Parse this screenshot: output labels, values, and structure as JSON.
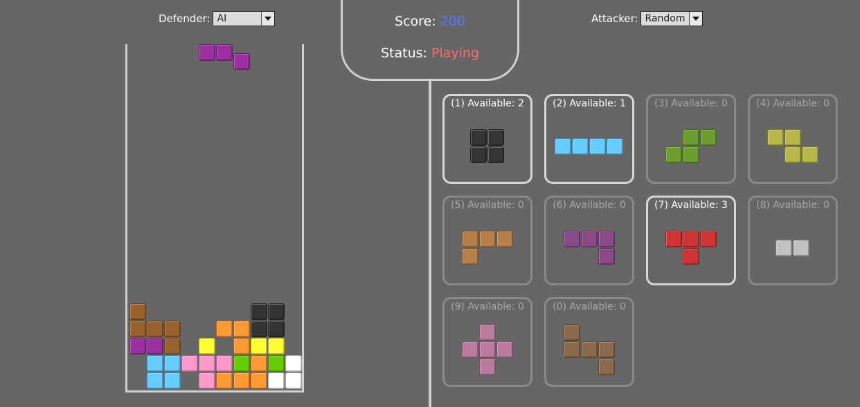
{
  "defender": {
    "label": "Defender:",
    "selected": "AI"
  },
  "attacker": {
    "label": "Attacker:",
    "selected": "Random"
  },
  "score": {
    "label": "Score:",
    "value": "200"
  },
  "status": {
    "label": "Status:",
    "value": "Playing"
  },
  "colors": {
    "black": "#353535",
    "cyan": "#66ccff",
    "green": "#6b9e2e",
    "olive": "#b8b84a",
    "tan": "#b5804a",
    "purple": "#8a4a8a",
    "red": "#d03333",
    "silver": "#c2c2c2",
    "pink": "#b87a9e",
    "brown": "#8a6a4a",
    "falling_purple": "#9b30a0",
    "b_brown": "#99612e",
    "b_orange": "#ff9933",
    "b_black": "#333333",
    "b_yellow": "#ffff33",
    "b_cyan": "#66ccff",
    "b_pink": "#ff99cc",
    "b_green": "#66cc00",
    "b_white": "#ffffff",
    "b_purple": "#9b30a0"
  },
  "board": {
    "columns": 10,
    "rows": 20,
    "falling_piece": {
      "color": "falling_purple",
      "cells": [
        [
          4,
          0
        ],
        [
          5,
          0
        ],
        [
          6,
          0.5
        ]
      ]
    },
    "settled": [
      {
        "c": 0,
        "r": 15,
        "k": "b_brown"
      },
      {
        "c": 7,
        "r": 15,
        "k": "b_black"
      },
      {
        "c": 8,
        "r": 15,
        "k": "b_black"
      },
      {
        "c": 0,
        "r": 16,
        "k": "b_brown"
      },
      {
        "c": 1,
        "r": 16,
        "k": "b_brown"
      },
      {
        "c": 2,
        "r": 16,
        "k": "b_brown"
      },
      {
        "c": 5,
        "r": 16,
        "k": "b_orange"
      },
      {
        "c": 6,
        "r": 16,
        "k": "b_orange"
      },
      {
        "c": 7,
        "r": 16,
        "k": "b_black"
      },
      {
        "c": 8,
        "r": 16,
        "k": "b_black"
      },
      {
        "c": 0,
        "r": 17,
        "k": "b_purple"
      },
      {
        "c": 1,
        "r": 17,
        "k": "b_purple"
      },
      {
        "c": 2,
        "r": 17,
        "k": "b_brown"
      },
      {
        "c": 4,
        "r": 17,
        "k": "b_yellow"
      },
      {
        "c": 6,
        "r": 17,
        "k": "b_orange"
      },
      {
        "c": 7,
        "r": 17,
        "k": "b_yellow"
      },
      {
        "c": 8,
        "r": 17,
        "k": "b_yellow"
      },
      {
        "c": 1,
        "r": 18,
        "k": "b_cyan"
      },
      {
        "c": 2,
        "r": 18,
        "k": "b_cyan"
      },
      {
        "c": 3,
        "r": 18,
        "k": "b_pink"
      },
      {
        "c": 4,
        "r": 18,
        "k": "b_pink"
      },
      {
        "c": 5,
        "r": 18,
        "k": "b_pink"
      },
      {
        "c": 6,
        "r": 18,
        "k": "b_green"
      },
      {
        "c": 7,
        "r": 18,
        "k": "b_orange"
      },
      {
        "c": 8,
        "r": 18,
        "k": "b_green"
      },
      {
        "c": 9,
        "r": 18,
        "k": "b_white"
      },
      {
        "c": 1,
        "r": 19,
        "k": "b_cyan"
      },
      {
        "c": 2,
        "r": 19,
        "k": "b_cyan"
      },
      {
        "c": 4,
        "r": 19,
        "k": "b_pink"
      },
      {
        "c": 5,
        "r": 19,
        "k": "b_orange"
      },
      {
        "c": 6,
        "r": 19,
        "k": "b_orange"
      },
      {
        "c": 7,
        "r": 19,
        "k": "b_orange"
      },
      {
        "c": 8,
        "r": 19,
        "k": "b_white"
      },
      {
        "c": 9,
        "r": 19,
        "k": "b_white"
      }
    ]
  },
  "pieces": [
    {
      "key": "1",
      "label": "(1) Available: 2",
      "available": 2,
      "color": "black",
      "icon": "o-piece-icon",
      "shape": [
        [
          0,
          0
        ],
        [
          1,
          0
        ],
        [
          0,
          1
        ],
        [
          1,
          1
        ]
      ]
    },
    {
      "key": "2",
      "label": "(2) Available: 1",
      "available": 1,
      "color": "cyan",
      "icon": "i-piece-icon",
      "shape": [
        [
          0,
          0
        ],
        [
          1,
          0
        ],
        [
          2,
          0
        ],
        [
          3,
          0
        ]
      ]
    },
    {
      "key": "3",
      "label": "(3) Available: 0",
      "available": 0,
      "color": "green",
      "icon": "s-piece-icon",
      "shape": [
        [
          1,
          0
        ],
        [
          2,
          0
        ],
        [
          0,
          1
        ],
        [
          1,
          1
        ]
      ]
    },
    {
      "key": "4",
      "label": "(4) Available: 0",
      "available": 0,
      "color": "olive",
      "icon": "z-piece-icon",
      "shape": [
        [
          0,
          0
        ],
        [
          1,
          0
        ],
        [
          1,
          1
        ],
        [
          2,
          1
        ]
      ]
    },
    {
      "key": "5",
      "label": "(5) Available: 0",
      "available": 0,
      "color": "tan",
      "icon": "l-piece-icon",
      "shape": [
        [
          0,
          0
        ],
        [
          1,
          0
        ],
        [
          2,
          0
        ],
        [
          0,
          1
        ]
      ]
    },
    {
      "key": "6",
      "label": "(6) Available: 0",
      "available": 0,
      "color": "purple",
      "icon": "j-piece-icon",
      "shape": [
        [
          0,
          0
        ],
        [
          1,
          0
        ],
        [
          2,
          0
        ],
        [
          2,
          1
        ]
      ]
    },
    {
      "key": "7",
      "label": "(7) Available: 3",
      "available": 3,
      "color": "red",
      "icon": "t-piece-icon",
      "shape": [
        [
          0,
          0
        ],
        [
          1,
          0
        ],
        [
          2,
          0
        ],
        [
          1,
          1
        ]
      ]
    },
    {
      "key": "8",
      "label": "(8) Available: 0",
      "available": 0,
      "color": "silver",
      "icon": "domino-piece-icon",
      "shape": [
        [
          0,
          0
        ],
        [
          1,
          0
        ]
      ]
    },
    {
      "key": "9",
      "label": "(9) Available: 0",
      "available": 0,
      "color": "pink",
      "icon": "plus-piece-icon",
      "shape": [
        [
          1,
          0
        ],
        [
          0,
          1
        ],
        [
          1,
          1
        ],
        [
          2,
          1
        ],
        [
          1,
          2
        ]
      ]
    },
    {
      "key": "0",
      "label": "(0) Available: 0",
      "available": 0,
      "color": "brown",
      "icon": "u-piece-icon",
      "shape": [
        [
          0,
          0
        ],
        [
          0,
          1
        ],
        [
          1,
          1
        ],
        [
          2,
          1
        ],
        [
          2,
          2
        ]
      ]
    }
  ]
}
